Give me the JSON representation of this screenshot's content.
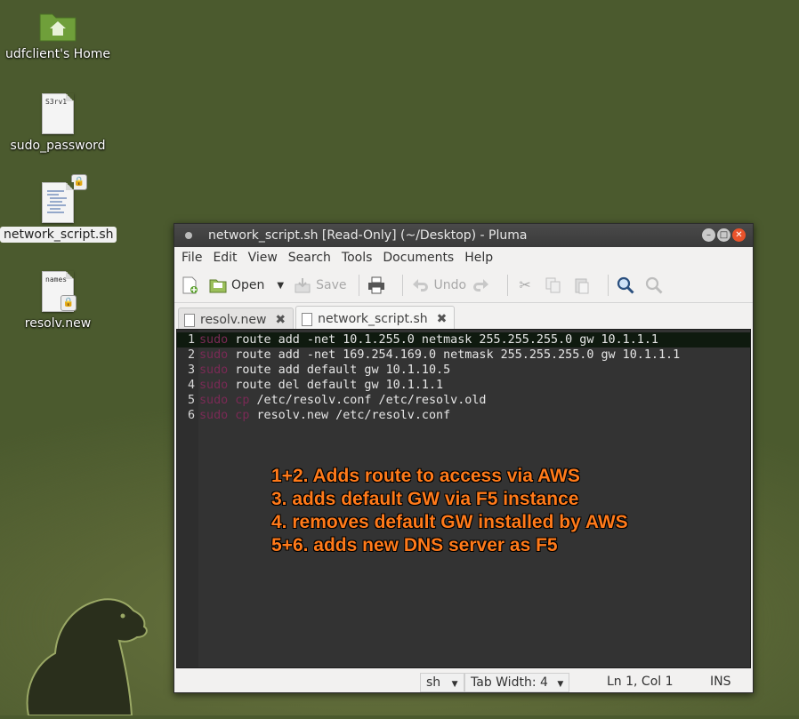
{
  "desktop": {
    "icons": [
      {
        "label": "udfclient's Home",
        "type": "folder"
      },
      {
        "label": "sudo_password",
        "type": "file",
        "preview": "S3rv1"
      },
      {
        "label": "network_script.sh",
        "type": "script"
      },
      {
        "label": "resolv.new",
        "type": "file",
        "preview": "names"
      }
    ]
  },
  "window": {
    "title": "network_script.sh [Read-Only] (~/Desktop) - Pluma",
    "menu": [
      "File",
      "Edit",
      "View",
      "Search",
      "Tools",
      "Documents",
      "Help"
    ],
    "toolbar": {
      "open_label": "Open",
      "save_label": "Save",
      "undo_label": "Undo"
    },
    "tabs": [
      {
        "label": "resolv.new"
      },
      {
        "label": "network_script.sh"
      }
    ],
    "editor": {
      "lines": [
        {
          "num": "1",
          "kw": "sudo",
          "rest": " route add -net 10.1.255.0 netmask 255.255.255.0 gw 10.1.1.1"
        },
        {
          "num": "2",
          "kw": "sudo",
          "rest": " route add -net 169.254.169.0 netmask 255.255.255.0 gw 10.1.1.1"
        },
        {
          "num": "3",
          "kw": "sudo",
          "rest": " route add default gw 10.1.10.5"
        },
        {
          "num": "4",
          "kw": "sudo",
          "rest": " route del default gw 10.1.1.1"
        },
        {
          "num": "5",
          "kw": "sudo cp",
          "rest": " /etc/resolv.conf /etc/resolv.old"
        },
        {
          "num": "6",
          "kw": "sudo cp",
          "rest": " resolv.new /etc/resolv.conf"
        }
      ]
    },
    "annotation": [
      "1+2. Adds route to access via AWS",
      "3. adds default GW via F5 instance",
      "4. removes default GW installed by AWS",
      "5+6. adds new DNS server as F5"
    ],
    "statusbar": {
      "language": "sh",
      "tab_width": "Tab Width:  4",
      "position": "Ln 1, Col 1",
      "mode": "INS"
    }
  },
  "colors": {
    "desktop_bg": "#4b5a2e",
    "editor_bg": "#333333",
    "keyword": "#7a2a55",
    "annotation": "#ff7a1a",
    "close_button": "#e9532b"
  }
}
